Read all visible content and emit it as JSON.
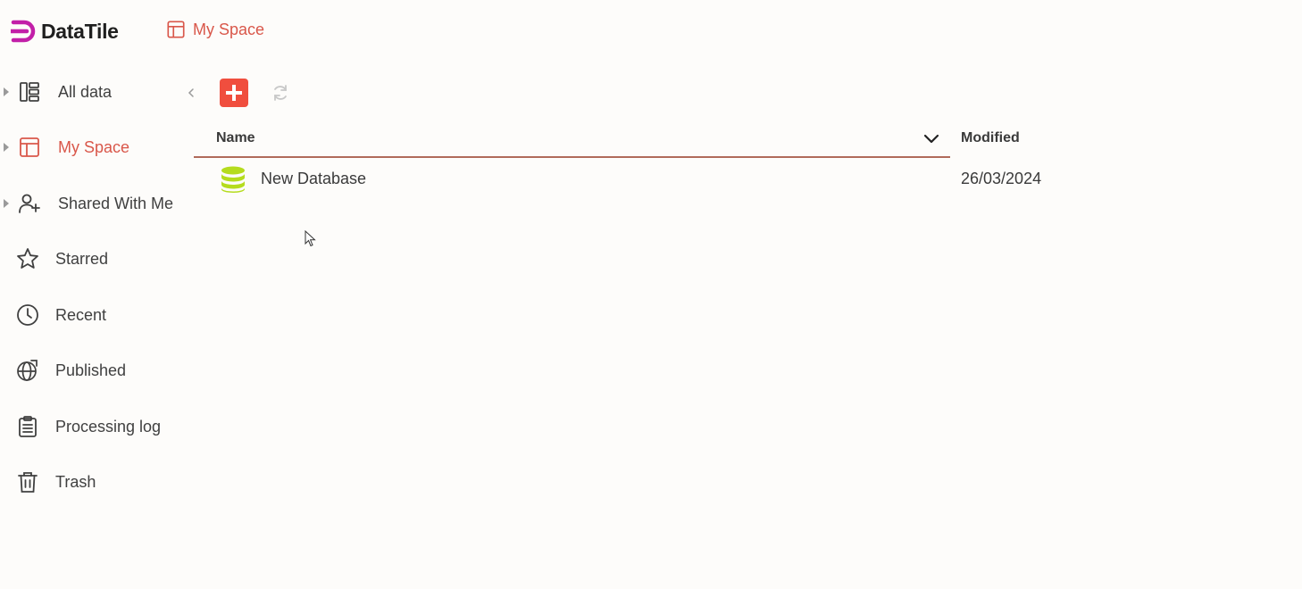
{
  "app": {
    "name": "DataTile",
    "brand_color": "#c21fa8",
    "accent_color": "#d9574a"
  },
  "breadcrumb": {
    "label": "My Space",
    "icon": "layout-icon"
  },
  "sidebar": {
    "items": [
      {
        "label": "All data",
        "icon": "columns-icon",
        "expandable": true,
        "active": false
      },
      {
        "label": "My Space",
        "icon": "layout-icon",
        "expandable": true,
        "active": true
      },
      {
        "label": "Shared With Me",
        "icon": "user-plus-icon",
        "expandable": true,
        "active": false
      },
      {
        "label": "Starred",
        "icon": "star-icon",
        "expandable": false,
        "active": false
      },
      {
        "label": "Recent",
        "icon": "clock-icon",
        "expandable": false,
        "active": false
      },
      {
        "label": "Published",
        "icon": "globe-icon",
        "expandable": false,
        "active": false
      },
      {
        "label": "Processing log",
        "icon": "clipboard-icon",
        "expandable": false,
        "active": false
      },
      {
        "label": "Trash",
        "icon": "trash-icon",
        "expandable": false,
        "active": false
      }
    ]
  },
  "toolbar": {
    "add_icon": "plus-icon",
    "refresh_icon": "refresh-icon"
  },
  "table": {
    "columns": [
      "Name",
      "Modified"
    ],
    "rows": [
      {
        "name": "New Database",
        "modified": "26/03/2024",
        "icon": "database-icon",
        "icon_color": "#b5dc1e"
      }
    ]
  }
}
